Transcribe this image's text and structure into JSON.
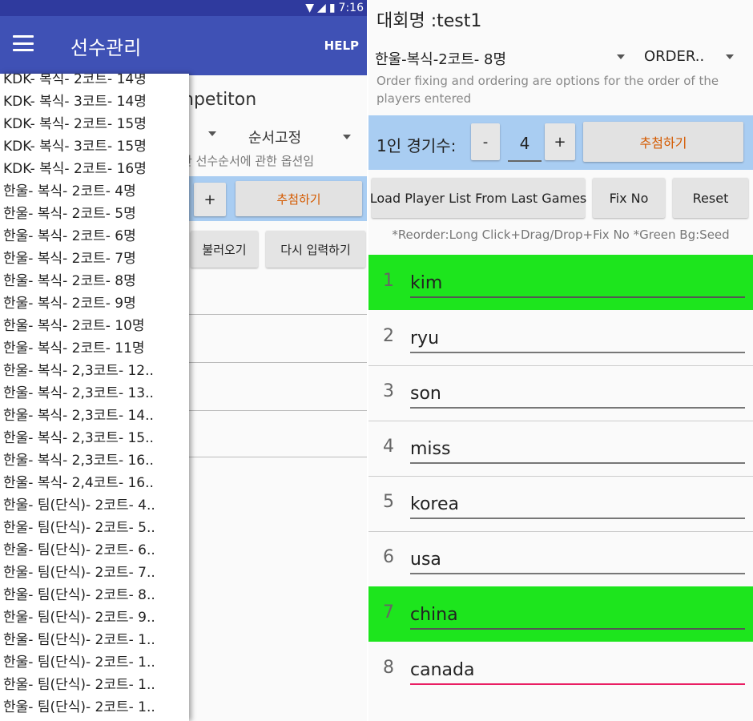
{
  "left": {
    "status_time": "7:16",
    "app_title": "선수관리",
    "help_label": "HELP",
    "under_title": "npetiton",
    "under_dropdown2": "순서고정",
    "under_help": "한 선수순서에 관한 옵션임",
    "under_plus": "+",
    "under_draw": "추첨하기",
    "under_load": "불러오기",
    "under_reenter": "다시 입력하기",
    "options": [
      "KDK- 복식- 2코트- 14명",
      "KDK- 복식- 3코트- 14명",
      "KDK- 복식- 2코트- 15명",
      "KDK- 복식- 3코트- 15명",
      "KDK- 복식- 2코트- 16명",
      "한울- 복식- 2코트- 4명",
      "한울- 복식- 2코트- 5명",
      "한울- 복식- 2코트- 6명",
      "한울- 복식- 2코트- 7명",
      "한울- 복식- 2코트- 8명",
      "한울- 복식- 2코트- 9명",
      "한울- 복식- 2코트- 10명",
      "한울- 복식- 2코트- 11명",
      "한울- 복식- 2,3코트- 12..",
      "한울- 복식- 2,3코트- 13..",
      "한울- 복식- 2,3코트- 14..",
      "한울- 복식- 2,3코트- 15..",
      "한울- 복식- 2,3코트- 16..",
      "한울- 복식- 2,4코트- 16..",
      "한울- 팀(단식)- 2코트- 4..",
      "한울- 팀(단식)- 2코트- 5..",
      "한울- 팀(단식)- 2코트- 6..",
      "한울- 팀(단식)- 2코트- 7..",
      "한울- 팀(단식)- 2코트- 8..",
      "한울- 팀(단식)- 2코트- 9..",
      "한울- 팀(단식)- 2코트- 1..",
      "한울- 팀(단식)- 2코트- 1..",
      "한울- 팀(단식)- 2코트- 1..",
      "한울- 팀(단식)- 2코트- 1.."
    ]
  },
  "right": {
    "competition_name": "대회명 :test1",
    "format_dropdown": "한울-복식-2코트- 8명",
    "order_dropdown": "ORDER..",
    "help_text": "Order fixing and ordering are options for the order of the players entered",
    "games_label": "1인 경기수:",
    "minus_label": "-",
    "games_value": "4",
    "plus_label": "+",
    "draw_label": "추첨하기",
    "load_label": "Load Player List From Last Games",
    "fixno_label": "Fix No",
    "reset_label": "Reset",
    "reorder_hint": "*Reorder:Long Click+Drag/Drop+Fix No *Green Bg:Seed",
    "players": [
      {
        "num": "1",
        "name": "kim",
        "seed": true
      },
      {
        "num": "2",
        "name": "ryu",
        "seed": false
      },
      {
        "num": "3",
        "name": "son",
        "seed": false
      },
      {
        "num": "4",
        "name": "miss",
        "seed": false
      },
      {
        "num": "5",
        "name": "korea",
        "seed": false
      },
      {
        "num": "6",
        "name": "usa",
        "seed": false
      },
      {
        "num": "7",
        "name": "china",
        "seed": true
      },
      {
        "num": "8",
        "name": "canada",
        "seed": false
      }
    ]
  },
  "colors": {
    "app_bar": "#3f51b5",
    "seed_bg": "#1de51d",
    "games_row_bg": "#a9cdf2",
    "draw_text": "#d45a00",
    "active_underline": "#e91e63"
  },
  "icons": [
    "menu-icon",
    "wifi-icon",
    "signal-icon",
    "battery-icon",
    "dropdown-arrow-icon"
  ]
}
